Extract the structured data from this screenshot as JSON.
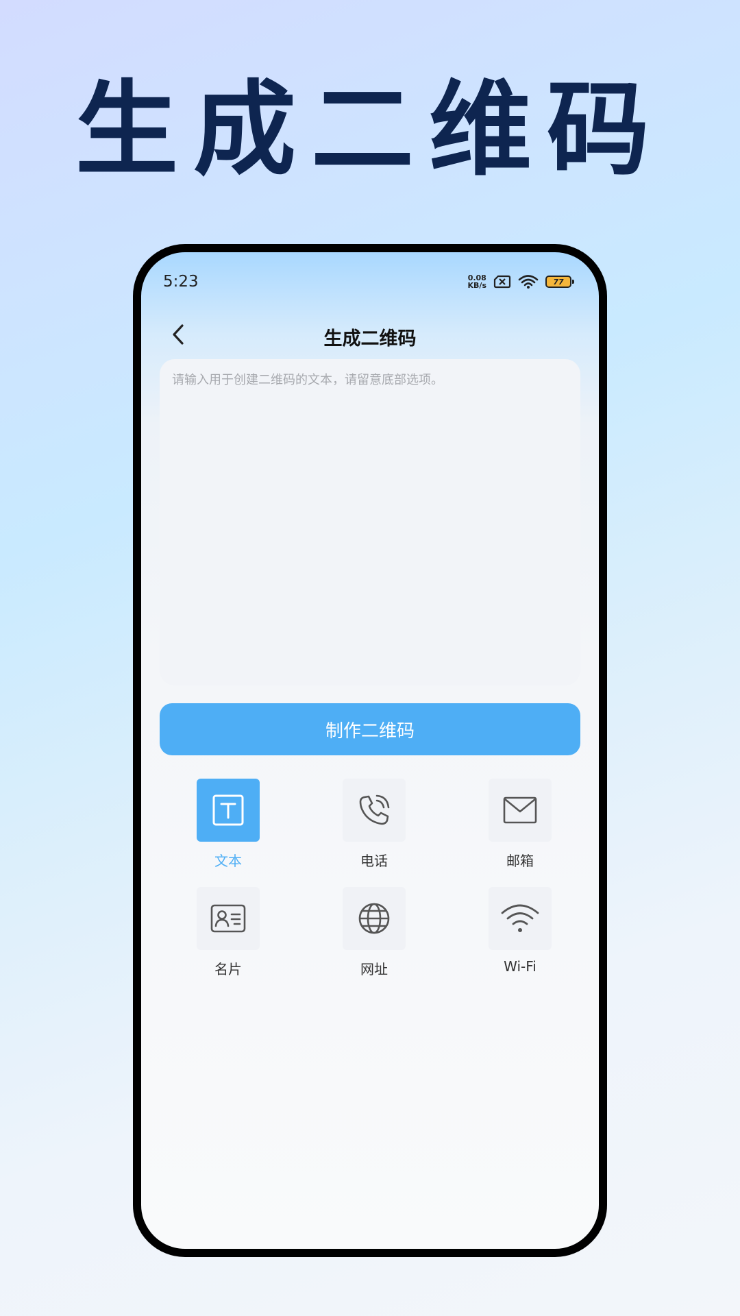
{
  "headline": "生成二维码",
  "status_bar": {
    "time": "5:23",
    "net_speed_value": "0.08",
    "net_speed_unit": "KB/s",
    "battery_level": "77"
  },
  "nav": {
    "title": "生成二维码"
  },
  "input": {
    "value": "",
    "placeholder": "请输入用于创建二维码的文本，请留意底部选项。"
  },
  "make_button": {
    "label": "制作二维码"
  },
  "types": [
    {
      "label": "文本",
      "icon": "text-icon",
      "active": true
    },
    {
      "label": "电话",
      "icon": "phone-icon",
      "active": false
    },
    {
      "label": "邮箱",
      "icon": "mail-icon",
      "active": false
    },
    {
      "label": "名片",
      "icon": "contact-card-icon",
      "active": false
    },
    {
      "label": "网址",
      "icon": "globe-icon",
      "active": false
    },
    {
      "label": "Wi-Fi",
      "icon": "wifi-icon",
      "active": false
    }
  ],
  "colors": {
    "accent": "#4eaef5",
    "headline": "#0e2550",
    "icon_stroke": "#555555"
  }
}
